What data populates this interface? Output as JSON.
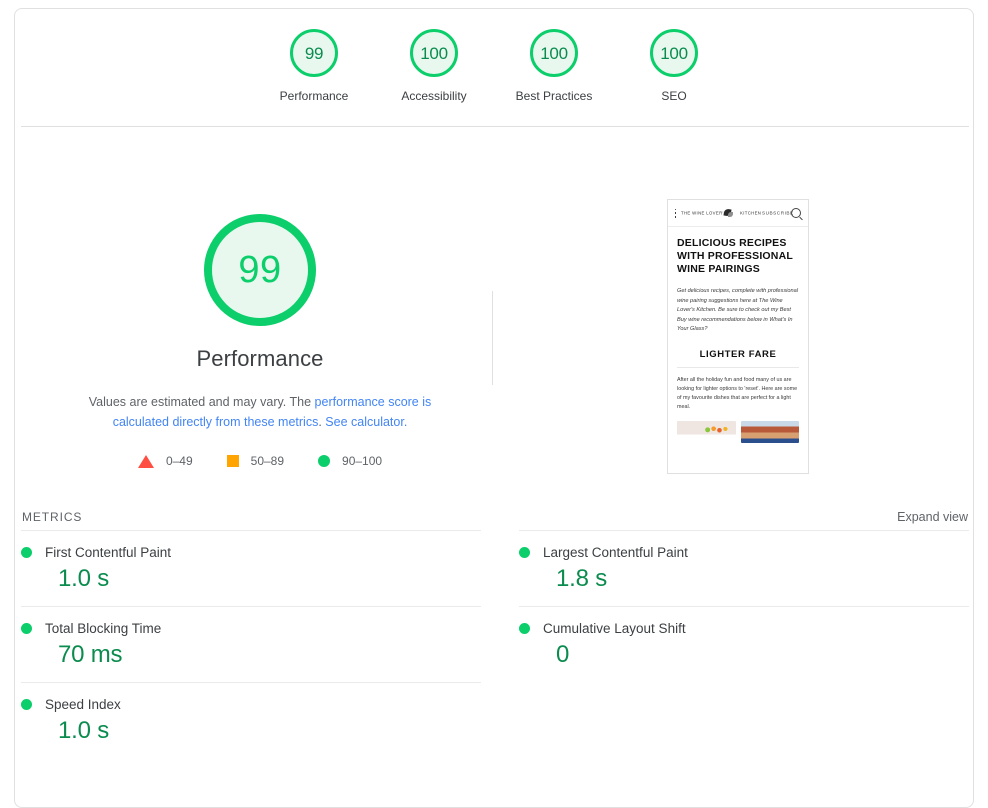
{
  "report": {
    "scores": [
      {
        "value": "99",
        "label": "Performance",
        "status": "pass"
      },
      {
        "value": "100",
        "label": "Accessibility",
        "status": "pass"
      },
      {
        "value": "100",
        "label": "Best Practices",
        "status": "pass"
      },
      {
        "value": "100",
        "label": "SEO",
        "status": "pass"
      }
    ],
    "category": {
      "gauge_value": "99",
      "title": "Performance",
      "description_part1": "Values are estimated and may vary. The ",
      "description_link1": "performance score is calculated directly from these metrics",
      "description_part2": ". ",
      "description_link2": "See calculator.",
      "legend": [
        {
          "icon": "triangle-icon",
          "label": "0–49",
          "color": "#ff4e42"
        },
        {
          "icon": "square-icon",
          "label": "50–89",
          "color": "#ffa400"
        },
        {
          "icon": "circle-icon",
          "label": "90–100",
          "color": "#0cce6b"
        }
      ]
    },
    "screenshot_thumb": {
      "brand": "THE WINE LOVER'S",
      "brand2": "KITCHEN",
      "subscribe": "SUBSCRIBE",
      "menu_icon": "hamburger-icon",
      "search_icon": "search-icon",
      "leaf_icon": "leaf-logo-icon",
      "heading": "DELICIOUS RECIPES WITH PROFESSIONAL WINE PAIRINGS",
      "paragraph": "Get delicious recipes, complete with professional wine pairing suggestions here at The Wine Lover's Kitchen. Be sure to check out my Best Buy wine recommendations below in What's In Your Glass?",
      "section_heading": "LIGHTER FARE",
      "paragraph2": "After all the holiday fun and food many of us are looking for lighter options to 'reset'. Here are some of my favourite dishes that are perfect for a light meal."
    },
    "metrics": {
      "title": "METRICS",
      "expand_label": "Expand view",
      "left": [
        {
          "name": "First Contentful Paint",
          "value": "1.0 s",
          "status": "pass"
        },
        {
          "name": "Total Blocking Time",
          "value": "70 ms",
          "status": "pass"
        },
        {
          "name": "Speed Index",
          "value": "1.0 s",
          "status": "pass"
        }
      ],
      "right": [
        {
          "name": "Largest Contentful Paint",
          "value": "1.8 s",
          "status": "pass"
        },
        {
          "name": "Cumulative Layout Shift",
          "value": "0",
          "status": "pass"
        }
      ]
    },
    "colors": {
      "pass": "#0cce6b",
      "average": "#ffa400",
      "fail": "#ff4e42",
      "link": "#4285f4",
      "text": "#3c4043",
      "muted": "#5f6368"
    }
  }
}
